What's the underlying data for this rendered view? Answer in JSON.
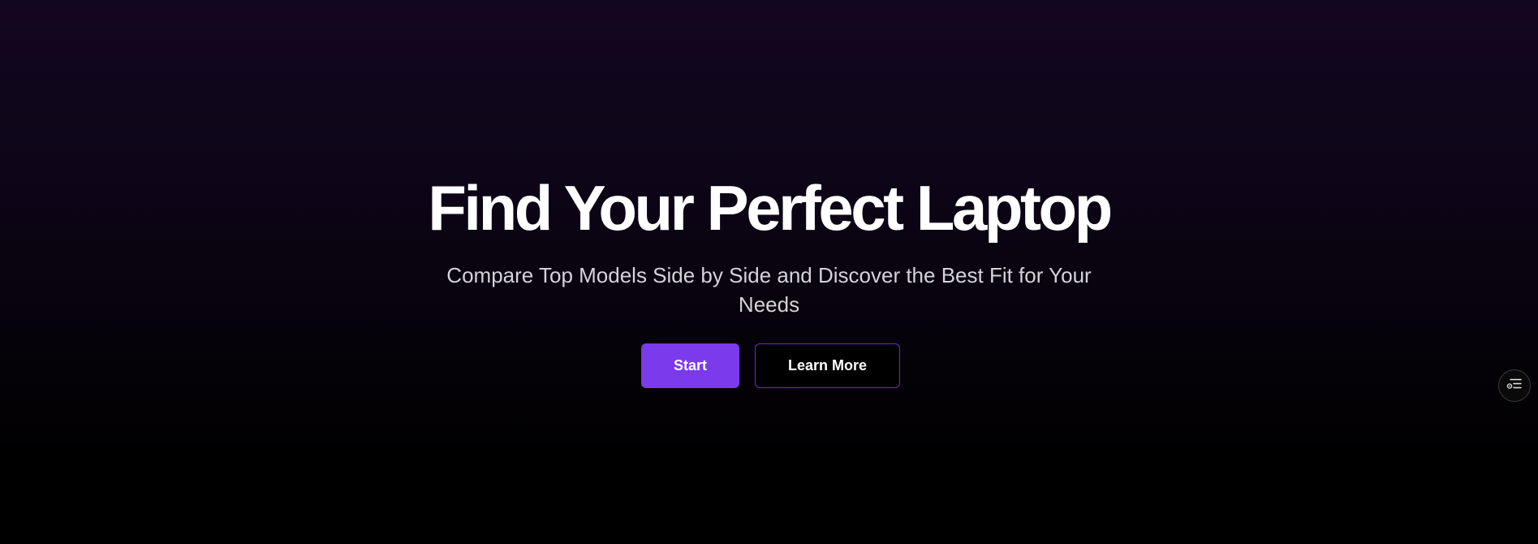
{
  "hero": {
    "title": "Find Your Perfect Laptop",
    "subtitle": "Compare Top Models Side by Side and Discover the Best Fit for Your Needs",
    "buttons": {
      "start_label": "Start",
      "learn_more_label": "Learn More"
    }
  },
  "floating_widget": {
    "icon": "settings-list-icon"
  },
  "colors": {
    "accent": "#7c3aed",
    "accent_border": "#6d28d9",
    "background_top": "#120720",
    "background_bottom": "#000000",
    "title_text": "#ffffff",
    "subtitle_text": "#d4d2da"
  }
}
